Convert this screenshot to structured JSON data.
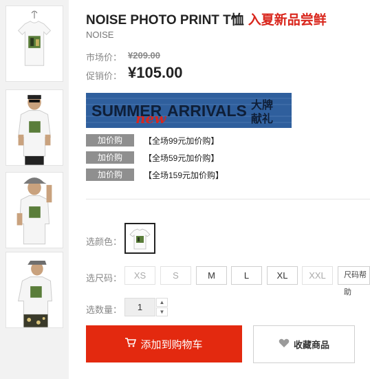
{
  "product": {
    "title": "NOISE PHOTO PRINT T恤",
    "promo": "入夏新品尝鲜",
    "brand": "NOISE"
  },
  "price": {
    "market_label": "市场价：",
    "market_value": "¥209.00",
    "sale_label": "促销价：",
    "sale_value": "¥105.00"
  },
  "banner": {
    "left": "SUMMER",
    "script": "new",
    "right": "ARRIVALS",
    "cn_top": "大牌",
    "cn_bottom": "献礼"
  },
  "addons": [
    {
      "tag": "加价购",
      "text": "【全场99元加价购】"
    },
    {
      "tag": "加价购",
      "text": "【全场59元加价购】"
    },
    {
      "tag": "加价购",
      "text": "【全场159元加价购】"
    }
  ],
  "options": {
    "color_label": "选颜色：",
    "size_label": "选尺码：",
    "sizes": [
      "XS",
      "S",
      "M",
      "L",
      "XL",
      "XXL"
    ],
    "size_help": "尺码帮助",
    "qty_label": "选数量：",
    "qty_value": "1"
  },
  "actions": {
    "cart": "添加到购物车",
    "favorite": "收藏商品"
  },
  "colors": {
    "accent_red": "#e3290f",
    "promo_red": "#d9261c",
    "banner_blue": "#2f5f9d",
    "tag_gray": "#8f8f8f"
  }
}
